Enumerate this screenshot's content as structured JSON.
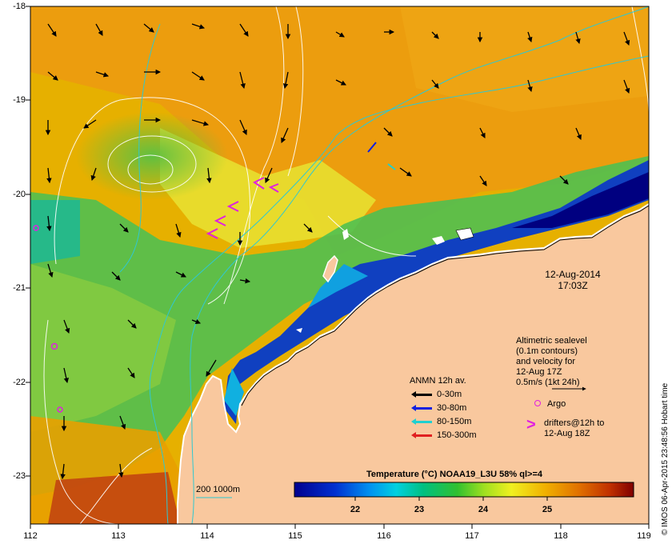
{
  "map": {
    "x_ticks": [
      "112",
      "113",
      "114",
      "115",
      "116",
      "117",
      "118",
      "119"
    ],
    "y_ticks": [
      "-18",
      "-19",
      "-20",
      "-21",
      "-22",
      "-23"
    ],
    "lon_range": [
      112,
      119
    ],
    "lat_range": [
      -23.5,
      -18
    ],
    "date": "12-Aug-2014",
    "time": "17:03Z",
    "altimetry_note": [
      "Altimetric sealevel",
      "(0.1m contours)",
      "and velocity for",
      "12-Aug 17Z",
      "0.5m/s (1kt 24h)"
    ],
    "argo_label": "Argo",
    "drifters_label": [
      "drifters@12h to",
      "12-Aug 18Z"
    ],
    "isobath_label": "200  1000m",
    "side_label": "© IMOS 06-Apr-2015 23:48:56 Hobart time",
    "colors": {
      "land": "#f9c89e",
      "argo": "#e020e0",
      "drifter": "#e020e0"
    }
  },
  "anmn": {
    "title": "ANMN 12h av.",
    "items": [
      {
        "label": "0-30m",
        "color": "#000000"
      },
      {
        "label": "30-80m",
        "color": "#1020e0"
      },
      {
        "label": "80-150m",
        "color": "#20d0d0"
      },
      {
        "label": "150-300m",
        "color": "#e02020"
      }
    ]
  },
  "colorbar": {
    "title": "Temperature (°C) NOAA19_L3U 58% ql>=4",
    "ticks": [
      "22",
      "23",
      "24",
      "25"
    ],
    "range": [
      21.1,
      25.9
    ]
  }
}
